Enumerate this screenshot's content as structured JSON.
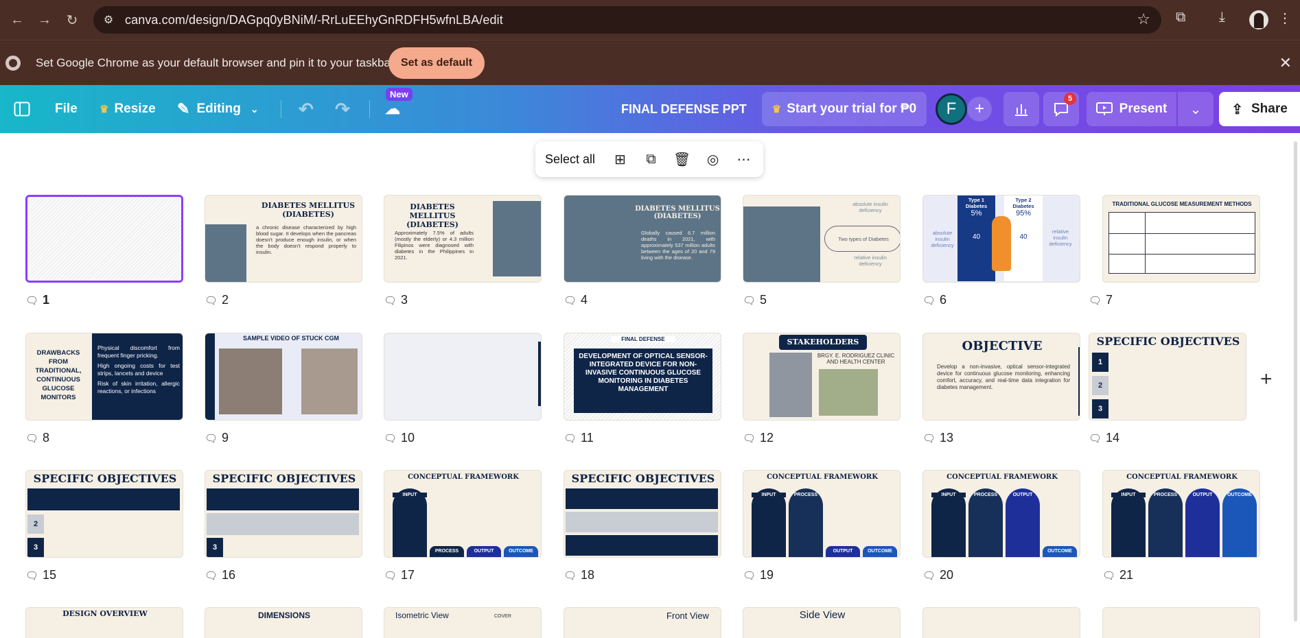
{
  "browser": {
    "url": "canva.com/design/DAGpq0yBNiM/-RrLuEEhyGnRDFH5wfnLBA/edit",
    "infobar_message": "Set Google Chrome as your default browser and pin it to your taskbar",
    "set_default_label": "Set as default"
  },
  "header": {
    "file_label": "File",
    "resize_label": "Resize",
    "editing_label": "Editing",
    "new_badge": "New",
    "design_title": "FINAL DEFENSE PPT",
    "trial_label": "Start your trial for ₱0",
    "avatar_initial": "F",
    "comments_count": "5",
    "present_label": "Present",
    "share_label": "Share",
    "brand_gradient": [
      "#18b7c9",
      "#3a8ad8",
      "#7b3fe4"
    ]
  },
  "toolbar": {
    "select_all_label": "Select all"
  },
  "pages": [
    {
      "number": "1"
    },
    {
      "number": "2"
    },
    {
      "number": "3"
    },
    {
      "number": "4"
    },
    {
      "number": "5"
    },
    {
      "number": "6"
    },
    {
      "number": "7"
    },
    {
      "number": "8"
    },
    {
      "number": "9"
    },
    {
      "number": "10"
    },
    {
      "number": "11"
    },
    {
      "number": "12"
    },
    {
      "number": "13"
    },
    {
      "number": "14"
    },
    {
      "number": "15"
    },
    {
      "number": "16"
    },
    {
      "number": "17"
    },
    {
      "number": "18"
    },
    {
      "number": "19"
    },
    {
      "number": "20"
    },
    {
      "number": "21"
    }
  ],
  "slides": {
    "s2": {
      "title": "DIABETES MELLITUS (DIABETES)",
      "text": "a chronic disease characterized by high blood sugar. It develops when the pancreas doesn't produce enough insulin, or when the body doesn't respond properly to insulin."
    },
    "s3": {
      "title": "DIABETES MELLITUS (DIABETES)",
      "text": "Approximately 7.5% of adults (mostly the elderly) or 4.3 million Filipinos were diagnosed with diabetes in the Philippines in 2021."
    },
    "s4": {
      "title": "DIABETES MELLITUS (DIABETES)",
      "text": "Globally caused 6.7 million deaths in 2021, with approximately 537 million adults between the ages of 20 and 79 living with the disease."
    },
    "s5": {
      "top": "absolute insulin deficiency",
      "mid": "Two types of Diabetes",
      "bottom": "relative insulin deficiency"
    },
    "s6": {
      "left": "absolute insulin deficiency",
      "right": "relative insulin deficiency",
      "type1": "Type 1 Diabetes",
      "type2": "Type 2 Diabetes",
      "p1": "5%",
      "p2": "95%",
      "n1": "40",
      "n2": "40"
    },
    "s7": {
      "title": "TRADITIONAL GLUCOSE MEASUREMENT METHODS"
    },
    "s8": {
      "title": "DRAWBACKS FROM TRADITIONAL, CONTINUOUS GLUCOSE MONITORS",
      "b1": "Physical discomfort from frequent finger pricking.",
      "b2": "High ongoing costs for test strips, lancets and device",
      "b3": "Risk of skin irritation, allergic reactions, or infections"
    },
    "s9": {
      "title": "SAMPLE VIDEO OF STUCK CGM"
    },
    "s11": {
      "tag": "FINAL DEFENSE",
      "title": "DEVELOPMENT OF OPTICAL SENSOR-INTEGRATED DEVICE FOR NON-INVASIVE CONTINUOUS GLUCOSE MONITORING IN DIABETES MANAGEMENT"
    },
    "s12": {
      "title": "STAKEHOLDERS",
      "text": "BRGY. E. RODRIGUEZ CLINIC AND HEALTH CENTER"
    },
    "s13": {
      "title": "OBJECTIVE",
      "text": "Develop a non-invasive, optical sensor-integrated device for continuous glucose monitoring, enhancing comfort, accuracy, and real-time data integration for diabetes management."
    },
    "so_title": "SPECIFIC OBJECTIVES",
    "cf_title": "CONCEPTUAL FRAMEWORK",
    "cf": {
      "input": "INPUT",
      "process": "PROCESS",
      "output": "OUTPUT",
      "outcome": "OUTCOME"
    },
    "r4": {
      "a": "DESIGN OVERVIEW",
      "b": "DIMENSIONS",
      "c": "Isometric View",
      "c2": "COVER",
      "d": "Front View",
      "e": "Side View"
    }
  }
}
